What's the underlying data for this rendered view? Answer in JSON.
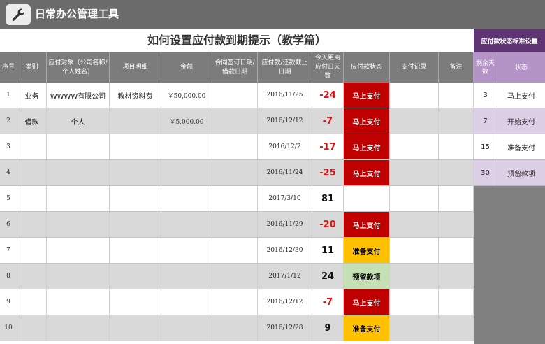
{
  "app": {
    "title": "日常办公管理工具",
    "icon": "wrench-icon"
  },
  "sheet_title": "如何设置应付款到期提示（教学篇）",
  "columns": [
    "序号",
    "类别",
    "应付对象（公司名称/个人姓名）",
    "项目明细",
    "金额",
    "合同签订日期/借款日期",
    "应付款/还款截止日期",
    "今天距离应付日天数",
    "应付款状态",
    "支付记录",
    "备注"
  ],
  "rows": [
    {
      "no": "1",
      "category": "业务",
      "payee": "WWWW有限公司",
      "item": "教材资料费",
      "amount": "￥50,000.00",
      "sign_date": "",
      "due_date": "2016/11/25",
      "days": "-24",
      "status": "马上支付",
      "payment": "",
      "note": ""
    },
    {
      "no": "2",
      "category": "借款",
      "payee": "个人",
      "item": "",
      "amount": "￥5,000.00",
      "sign_date": "",
      "due_date": "2016/12/12",
      "days": "-7",
      "status": "马上支付",
      "payment": "",
      "note": ""
    },
    {
      "no": "3",
      "category": "",
      "payee": "",
      "item": "",
      "amount": "",
      "sign_date": "",
      "due_date": "2016/12/2",
      "days": "-17",
      "status": "马上支付",
      "payment": "",
      "note": ""
    },
    {
      "no": "4",
      "category": "",
      "payee": "",
      "item": "",
      "amount": "",
      "sign_date": "",
      "due_date": "2016/11/24",
      "days": "-25",
      "status": "马上支付",
      "payment": "",
      "note": ""
    },
    {
      "no": "5",
      "category": "",
      "payee": "",
      "item": "",
      "amount": "",
      "sign_date": "",
      "due_date": "2017/3/10",
      "days": "81",
      "status": "",
      "payment": "",
      "note": ""
    },
    {
      "no": "6",
      "category": "",
      "payee": "",
      "item": "",
      "amount": "",
      "sign_date": "",
      "due_date": "2016/11/29",
      "days": "-20",
      "status": "马上支付",
      "payment": "",
      "note": ""
    },
    {
      "no": "7",
      "category": "",
      "payee": "",
      "item": "",
      "amount": "",
      "sign_date": "",
      "due_date": "2016/12/30",
      "days": "11",
      "status": "准备支付",
      "payment": "",
      "note": ""
    },
    {
      "no": "8",
      "category": "",
      "payee": "",
      "item": "",
      "amount": "",
      "sign_date": "",
      "due_date": "2017/1/12",
      "days": "24",
      "status": "预留款项",
      "payment": "",
      "note": ""
    },
    {
      "no": "9",
      "category": "",
      "payee": "",
      "item": "",
      "amount": "",
      "sign_date": "",
      "due_date": "2016/12/12",
      "days": "-7",
      "status": "马上支付",
      "payment": "",
      "note": ""
    },
    {
      "no": "10",
      "category": "",
      "payee": "",
      "item": "",
      "amount": "",
      "sign_date": "",
      "due_date": "2016/12/28",
      "days": "9",
      "status": "准备支付",
      "payment": "",
      "note": ""
    }
  ],
  "status_colors": {
    "马上支付": {
      "bg": "#c00000",
      "fg": "#ffffff"
    },
    "准备支付": {
      "bg": "#ffc000",
      "fg": "#000000"
    },
    "预留款项": {
      "bg": "#c5e0b4",
      "fg": "#000000"
    }
  },
  "side": {
    "title": "应付款状态标准设置",
    "columns": [
      "剩余天数",
      "状态"
    ],
    "rows": [
      {
        "days": "3",
        "status": "马上支付"
      },
      {
        "days": "7",
        "status": "开始支付"
      },
      {
        "days": "15",
        "status": "准备支付"
      },
      {
        "days": "30",
        "status": "预留款项"
      }
    ]
  },
  "colors": {
    "titlebar": "#6b6b6b",
    "header": "#7c7c7c",
    "side_header": "#5e3472",
    "side_subheader": "#b493c6"
  }
}
